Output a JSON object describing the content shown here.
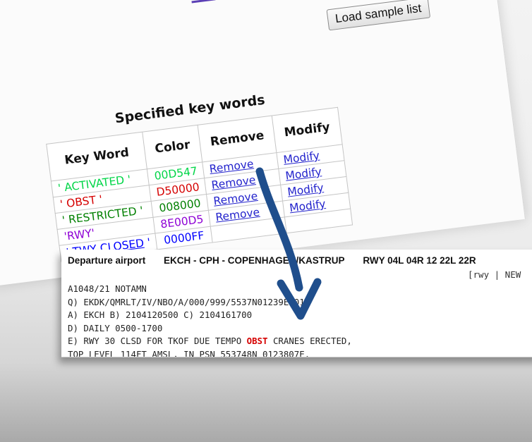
{
  "keyword_panel": {
    "load_button": "Load sample list",
    "caption": "Specified key words",
    "headers": {
      "keyword": "Key Word",
      "color": "Color",
      "remove": "Remove",
      "modify": "Modify"
    },
    "rows": [
      {
        "keyword": "' ACTIVATED '",
        "color": "00D547",
        "remove": "Remove",
        "modify": "Modify"
      },
      {
        "keyword": "' OBST '",
        "color": "D50000",
        "remove": "Remove",
        "modify": "Modify"
      },
      {
        "keyword": "' RESTRICTED '",
        "color": "008000",
        "remove": "Remove",
        "modify": "Modify"
      },
      {
        "keyword": "'RWY'",
        "color": "8E00D5",
        "remove": "Remove",
        "modify": "Modify"
      },
      {
        "keyword_prefix": "' ",
        "keyword_link": "TWY CLOSED",
        "keyword_suffix": " '",
        "color": "0000FF"
      }
    ]
  },
  "notam": {
    "header": {
      "label": "Departure airport",
      "airport": "EKCH - CPH - COPENHAGEN/KASTRUP",
      "runways": "RWY  04L  04R  12  22L  22R"
    },
    "tag_line": "[rwy | NEW",
    "lines": [
      "A1048/21 NOTAMN",
      "Q) EKDK/QMRLT/IV/NBO/A/000/999/5537N01239E001",
      "A) EKCH B) 2104120500 C) 2104161700",
      "D) DAILY 0500-1700"
    ],
    "line_e_before": "E) RWY 30 CLSD FOR TKOF DUE TEMPO ",
    "line_e_keyword": "OBST",
    "line_e_after": " CRANES ERECTED,",
    "line_last": "TOP LEVEL 114FT AMSL, IN PSN 553748N 0123807E."
  }
}
